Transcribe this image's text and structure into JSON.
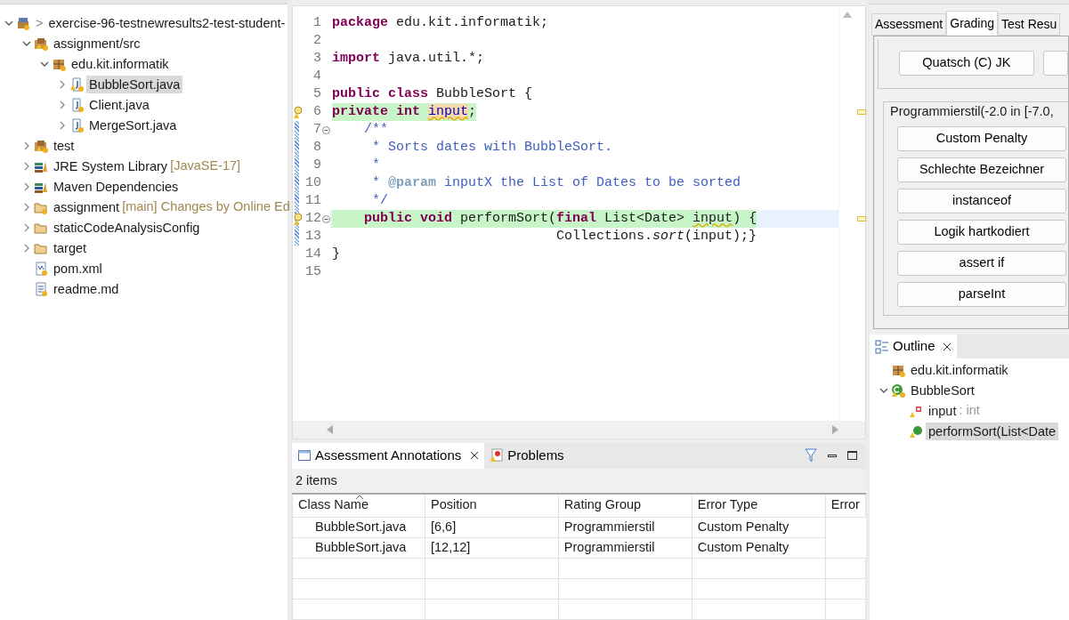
{
  "project_explorer": {
    "items": [
      {
        "label": "exercise-96-testnewresults2-test-student-",
        "prefix": ">",
        "kind": "project",
        "expanded": true,
        "selected": false,
        "children": [
          {
            "label": "assignment/src",
            "kind": "source-folder",
            "expanded": true,
            "selected": false,
            "children": [
              {
                "label": "edu.kit.informatik",
                "kind": "package",
                "expanded": true,
                "selected": false,
                "children": [
                  {
                    "label": "BubbleSort.java",
                    "kind": "java-warning",
                    "expanded": false,
                    "selected": true
                  },
                  {
                    "label": "Client.java",
                    "kind": "java-file",
                    "expanded": false,
                    "selected": false
                  },
                  {
                    "label": "MergeSort.java",
                    "kind": "java-file",
                    "expanded": false,
                    "selected": false
                  }
                ]
              }
            ]
          },
          {
            "label": "test",
            "kind": "source-folder",
            "expanded": false,
            "selected": false
          },
          {
            "label": "JRE System Library",
            "decoration": "[JavaSE-17]",
            "kind": "library",
            "expanded": false,
            "selected": false
          },
          {
            "label": "Maven Dependencies",
            "kind": "library",
            "expanded": false,
            "selected": false
          },
          {
            "label": "assignment",
            "decoration": "[main] Changes by Online Ed",
            "kind": "repo-folder",
            "expanded": false,
            "selected": false
          },
          {
            "label": "staticCodeAnalysisConfig",
            "kind": "folder",
            "expanded": false,
            "selected": false
          },
          {
            "label": "target",
            "kind": "folder",
            "expanded": false,
            "selected": false
          },
          {
            "label": "pom.xml",
            "kind": "xml-file",
            "selected": false
          },
          {
            "label": "readme.md",
            "kind": "text-file",
            "selected": false
          }
        ]
      }
    ]
  },
  "editor": {
    "lines": [
      {
        "number": "1",
        "tokens": [
          {
            "kind": "keyword",
            "text": "package"
          },
          {
            "kind": "plain",
            "text": " edu.kit.informatik;"
          }
        ]
      },
      {
        "number": "2"
      },
      {
        "number": "3",
        "tokens": [
          {
            "kind": "keyword",
            "text": "import"
          },
          {
            "kind": "plain",
            "text": " java.util.*;"
          }
        ]
      },
      {
        "number": "4"
      },
      {
        "number": "5",
        "tokens": [
          {
            "kind": "keyword",
            "text": "public class"
          },
          {
            "kind": "plain",
            "text": " BubbleSort {"
          }
        ]
      },
      {
        "number": "6",
        "warning": true,
        "highlighted": true,
        "tokens": [
          {
            "kind": "keyword",
            "text": "private int "
          },
          {
            "kind": "field-occurrence",
            "text": "input"
          },
          {
            "kind": "plain",
            "text": ";"
          }
        ]
      },
      {
        "number": "7",
        "fold": true,
        "changed": true,
        "tokens": [
          {
            "kind": "comment",
            "text": "    /**"
          }
        ]
      },
      {
        "number": "8",
        "changed": true,
        "tokens": [
          {
            "kind": "comment",
            "text": "     * Sorts dates with BubbleSort."
          }
        ]
      },
      {
        "number": "9",
        "changed": true,
        "tokens": [
          {
            "kind": "comment",
            "text": "     *"
          }
        ]
      },
      {
        "number": "10",
        "changed": true,
        "tokens": [
          {
            "kind": "comment",
            "text": "     * "
          },
          {
            "kind": "doctag",
            "text": "@param"
          },
          {
            "kind": "comment",
            "text": " inputX the List of Dates to be sorted"
          }
        ]
      },
      {
        "number": "11",
        "changed": true,
        "tokens": [
          {
            "kind": "comment",
            "text": "     */"
          }
        ]
      },
      {
        "number": "12",
        "warning": true,
        "fold": true,
        "changed": true,
        "highlighted": true,
        "current": true,
        "tokens": [
          {
            "kind": "keyword",
            "text": "    public void"
          },
          {
            "kind": "plain",
            "text": " performSort("
          },
          {
            "kind": "keyword",
            "text": "final"
          },
          {
            "kind": "plain",
            "text": " List<Date> "
          },
          {
            "kind": "warned",
            "text": "input"
          },
          {
            "kind": "plain",
            "text": ") {"
          }
        ]
      },
      {
        "number": "13",
        "changed": true,
        "tokens": [
          {
            "kind": "plain",
            "text": "                            Collections."
          },
          {
            "kind": "static-method",
            "text": "sort"
          },
          {
            "kind": "plain",
            "text": "(input);}"
          }
        ]
      },
      {
        "number": "14",
        "tokens": [
          {
            "kind": "plain",
            "text": "}"
          }
        ]
      },
      {
        "number": "15"
      }
    ]
  },
  "bottom_panel": {
    "tabs": [
      {
        "label": "Assessment Annotations",
        "selected": true,
        "closable": true,
        "kind": "annotations"
      },
      {
        "label": "Problems",
        "selected": false,
        "kind": "problems"
      }
    ],
    "status": "2 items",
    "table": {
      "columns": [
        {
          "label": "Class Name",
          "sorted": true
        },
        {
          "label": "Position"
        },
        {
          "label": "Rating Group"
        },
        {
          "label": "Error Type"
        },
        {
          "label": "Error"
        }
      ],
      "rows": [
        [
          "BubbleSort.java",
          "[6,6]",
          "Programmierstil",
          "Custom Penalty"
        ],
        [
          "BubbleSort.java",
          "[12,12]",
          "Programmierstil",
          "Custom Penalty"
        ]
      ]
    }
  },
  "grading": {
    "tabs": [
      {
        "label": "Assessment",
        "selected": false
      },
      {
        "label": "Grading",
        "selected": true
      },
      {
        "label": "Test Resu",
        "selected": false
      }
    ],
    "top_group": {
      "buttons": [
        "Quatsch (C) JK"
      ]
    },
    "group": {
      "title": "Programmierstil(-2.0 in [-7.0,",
      "buttons": [
        "Custom Penalty",
        "Schlechte Bezeichner",
        "instanceof",
        "Logik hartkodiert",
        "assert if",
        "parseInt"
      ]
    }
  },
  "outline": {
    "title": "Outline",
    "items": [
      {
        "label": "edu.kit.informatik",
        "kind": "package",
        "selected": false
      },
      {
        "label": "BubbleSort",
        "kind": "class",
        "expanded": true,
        "selected": false,
        "children": [
          {
            "label": "input",
            "type": " : int",
            "kind": "field",
            "selected": false
          },
          {
            "label": "performSort(List<Date",
            "kind": "method",
            "selected": true
          }
        ]
      }
    ]
  }
}
